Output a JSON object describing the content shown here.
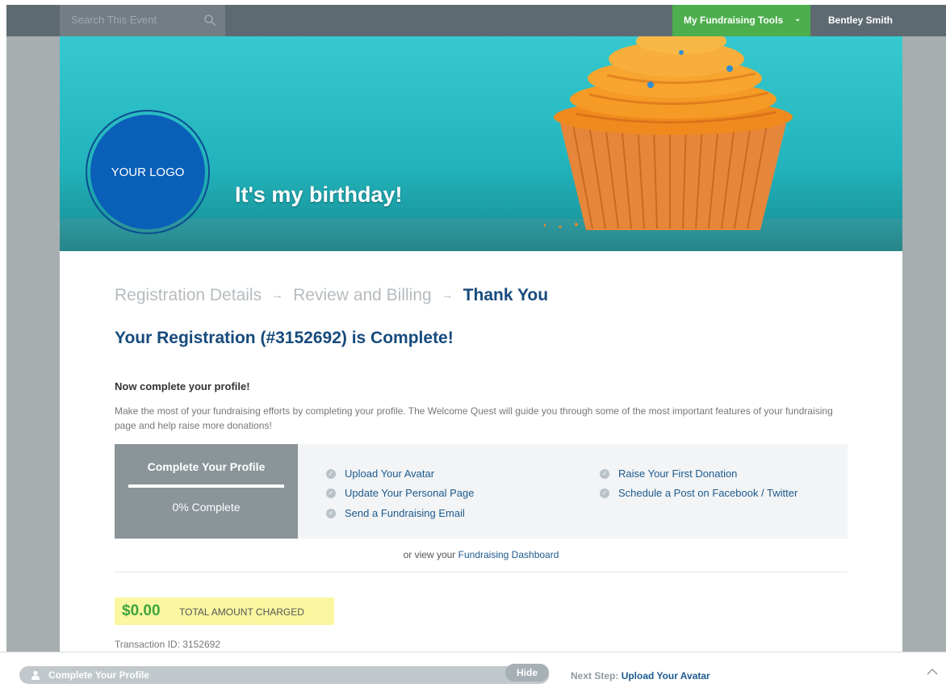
{
  "topbar": {
    "search_placeholder": "Search This Event",
    "search_icon": "search-icon",
    "tools_label": "My Fundraising Tools",
    "tools_icon": "chevron-down-icon",
    "user_name": "Bentley Smith"
  },
  "banner": {
    "logo_text": "YOUR LOGO",
    "title": "It's my birthday!"
  },
  "steps": {
    "items": [
      "Registration Details",
      "Review and Billing",
      "Thank You"
    ],
    "current_index": 2
  },
  "registration": {
    "title": "Your Registration (#3152692) is Complete!"
  },
  "profile": {
    "heading": "Now complete your profile!",
    "description": "Make the most of your fundraising efforts by completing your profile. The Welcome Quest will guide you through some of the most important features of your fundraising page and help raise more donations!"
  },
  "quest": {
    "side_title": "Complete Your Profile",
    "progress_label": "0% Complete",
    "progress_value": 0,
    "tasks_left": [
      "Upload Your Avatar",
      "Update Your Personal Page",
      "Send a Fundraising Email"
    ],
    "tasks_right": [
      "Raise Your First Donation",
      "Schedule a Post on Facebook / Twitter"
    ]
  },
  "dashboard": {
    "prefix": "or view your",
    "link": "Fundraising Dashboard"
  },
  "payment": {
    "amount": "$0.00",
    "label": "TOTAL AMOUNT CHARGED",
    "transaction": "Transaction ID: 3152692"
  },
  "bottombar": {
    "pill_label": "Complete Your Profile",
    "hide_label": "Hide",
    "next_prefix": "Next Step:",
    "next_link": "Upload Your Avatar"
  },
  "colors": {
    "topbar": "#5e6a72",
    "accent_green": "#4cae4c",
    "heading_blue": "#174a7c",
    "link_blue": "#1d5a8e",
    "highlight_yellow": "#faf7a0"
  }
}
